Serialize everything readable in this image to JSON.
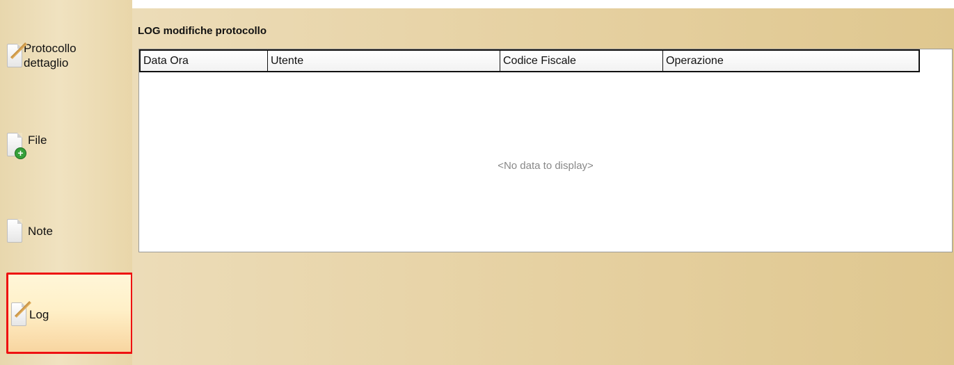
{
  "sidebar": {
    "items": [
      {
        "label_line1": "Protocollo",
        "label_line2": "dettaglio",
        "icon": "edit-document-icon"
      },
      {
        "label": "File",
        "icon": "add-file-icon"
      },
      {
        "label": "Note",
        "icon": "document-icon"
      },
      {
        "label": "Log",
        "icon": "edit-document-icon",
        "selected": true
      }
    ]
  },
  "main": {
    "title": "LOG modifiche protocollo",
    "grid": {
      "columns": [
        "Data Ora",
        "Utente",
        "Codice Fiscale",
        "Operazione"
      ],
      "rows": [],
      "empty_text": "<No data to display>"
    }
  },
  "colors": {
    "selected_outline": "#ee1111",
    "panel_background": "#e6d1a2"
  }
}
